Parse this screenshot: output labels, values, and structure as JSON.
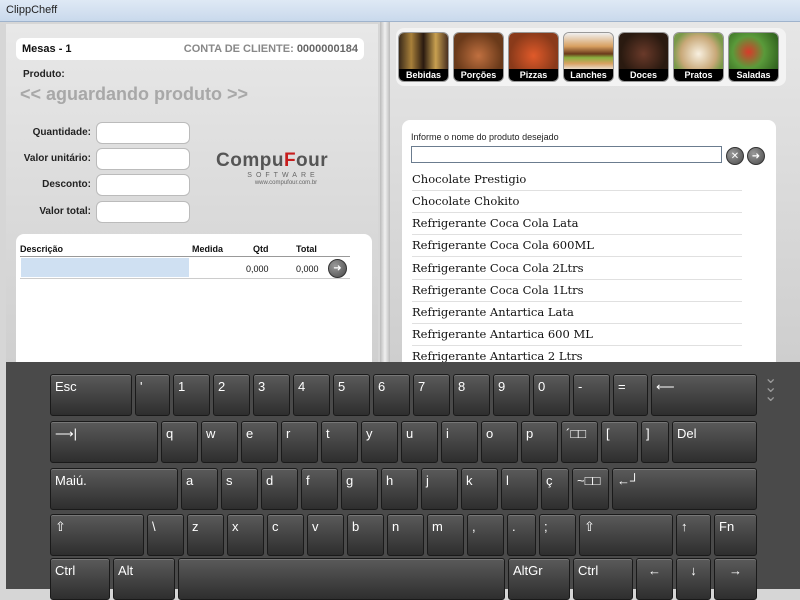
{
  "window": {
    "title": "ClippCheff"
  },
  "order": {
    "mesa": "Mesas - 1",
    "conta_label": "CONTA DE CLIENTE:",
    "conta_value": "0000000184",
    "produto_label": "Produto:",
    "produto_value": "<< aguardando produto >>",
    "fields": [
      {
        "label": "Quantidade:"
      },
      {
        "label": "Valor unitário:"
      },
      {
        "label": "Desconto:"
      },
      {
        "label": "Valor total:"
      }
    ]
  },
  "logo": {
    "main_a": "Compu",
    "main_f": "F",
    "main_b": "our",
    "sub": "SOFTWARE",
    "url": "www.compufour.com.br"
  },
  "items_table": {
    "headers": [
      "Descrição",
      "Medida",
      "Qtd",
      "Total"
    ],
    "row": {
      "qtd": "0,000",
      "total": "0,000"
    }
  },
  "categories": [
    {
      "name": "Bebidas",
      "color": "#6b4a2a"
    },
    {
      "name": "Porções",
      "color": "#8a5a30"
    },
    {
      "name": "Pizzas",
      "color": "#b8502a"
    },
    {
      "name": "Lanches",
      "color": "#c8a060"
    },
    {
      "name": "Doces",
      "color": "#5a3020"
    },
    {
      "name": "Pratos",
      "color": "#d8c8a0"
    },
    {
      "name": "Saladas",
      "color": "#5a8a3a"
    }
  ],
  "search": {
    "label": "Informe o nome do produto desejado",
    "value": "",
    "results": [
      "Chocolate Prestigio",
      "Chocolate Chokito",
      "Refrigerante Coca Cola Lata",
      "Refrigerante Coca Cola 600ML",
      "Refrigerante Coca Cola 2Ltrs",
      "Refrigerante Coca Cola 1Ltrs",
      "Refrigerante Antartica Lata",
      "Refrigerante Antartica 600 ML",
      "Refrigerante Antartica 2 Ltrs"
    ]
  },
  "keyboard": {
    "rows": [
      [
        "Esc",
        "'",
        "1",
        "2",
        "3",
        "4",
        "5",
        "6",
        "7",
        "8",
        "9",
        "0",
        "-",
        "=",
        "⟵"
      ],
      [
        "⟶|",
        "q",
        "w",
        "e",
        "r",
        "t",
        "y",
        "u",
        "i",
        "o",
        "p",
        "´□□",
        "[",
        "]",
        "Del"
      ],
      [
        "Maiú.",
        "a",
        "s",
        "d",
        "f",
        "g",
        "h",
        "j",
        "k",
        "l",
        "ç",
        "~□□",
        "←┘"
      ],
      [
        "⇧",
        "\\",
        "z",
        "x",
        "c",
        "v",
        "b",
        "n",
        "m",
        ",",
        ".",
        ";",
        "⇧",
        "↑",
        "Fn"
      ],
      [
        "Ctrl",
        "Alt",
        "",
        "AltGr",
        "Ctrl",
        "←",
        "↓",
        "→"
      ]
    ]
  },
  "icons": {
    "clear": "clear-icon",
    "go": "arrow-right-icon",
    "collapse": "collapse-keyboard-icon"
  }
}
